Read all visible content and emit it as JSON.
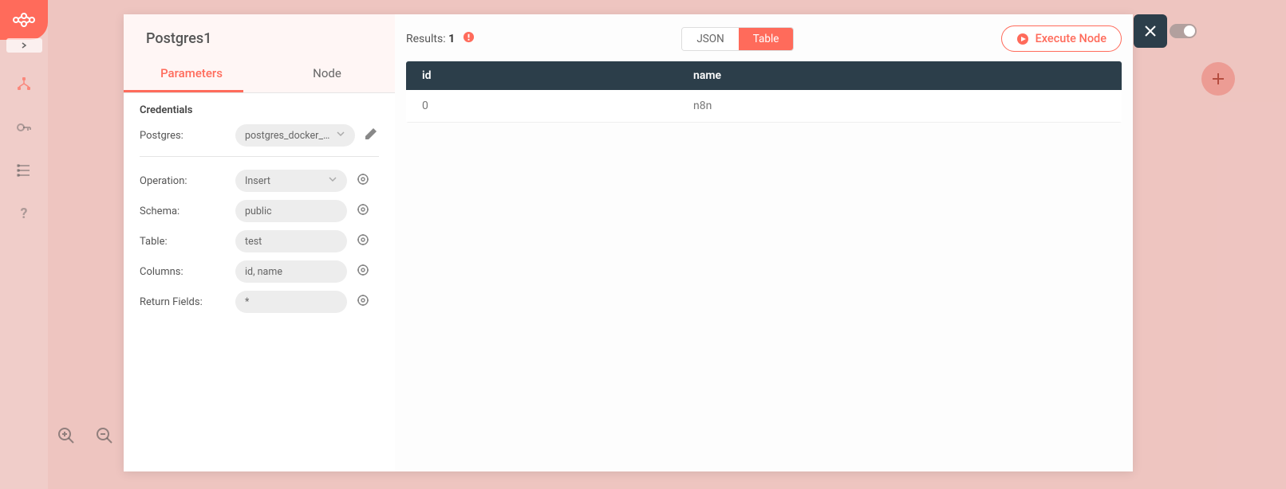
{
  "sidebar": {},
  "dialog": {
    "title": "Postgres1",
    "tabs": {
      "parameters": "Parameters",
      "node": "Node"
    },
    "credentials_label": "Credentials",
    "credential_row_label": "Postgres:",
    "credential_value": "postgres_docker_c...",
    "params": [
      {
        "label": "Operation:",
        "value": "Insert",
        "dropdown": true
      },
      {
        "label": "Schema:",
        "value": "public"
      },
      {
        "label": "Table:",
        "value": "test"
      },
      {
        "label": "Columns:",
        "value": "id, name"
      },
      {
        "label": "Return Fields:",
        "value": "*"
      }
    ]
  },
  "results": {
    "label": "Results:",
    "count": "1",
    "view_json": "JSON",
    "view_table": "Table",
    "execute_label": "Execute Node"
  },
  "table": {
    "headers": {
      "id": "id",
      "name": "name"
    },
    "rows": [
      {
        "id": "0",
        "name": "n8n"
      }
    ]
  }
}
